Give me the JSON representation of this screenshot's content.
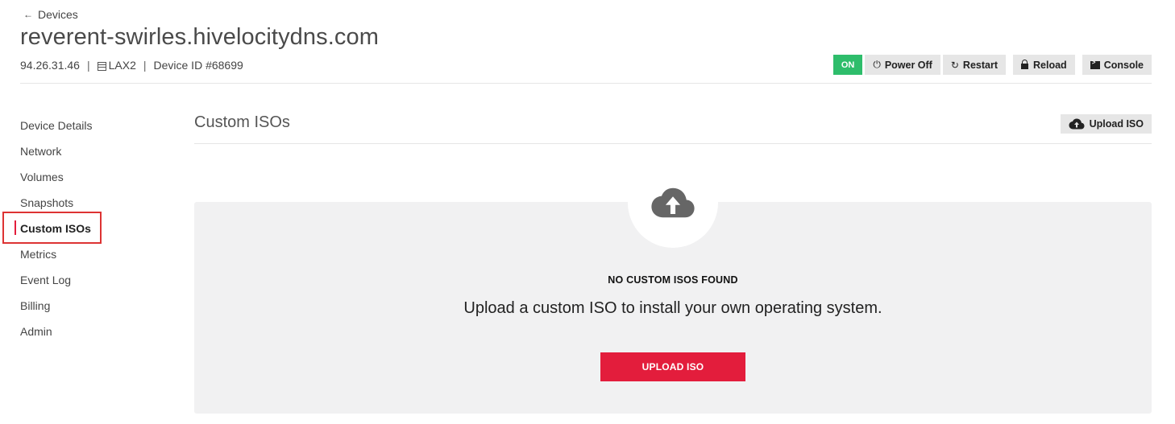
{
  "header": {
    "back_label": "Devices",
    "device_name": "reverent-swirles.hivelocitydns.com",
    "ip": "94.26.31.46",
    "datacenter": "LAX2",
    "device_id": "Device ID #68699"
  },
  "actions": {
    "status": "ON",
    "power_off": "Power Off",
    "restart": "Restart",
    "reload": "Reload",
    "console": "Console",
    "status_color": "#2ebd6b"
  },
  "sidebar": {
    "items": [
      {
        "label": "Device Details"
      },
      {
        "label": "Network"
      },
      {
        "label": "Volumes"
      },
      {
        "label": "Snapshots"
      },
      {
        "label": "Custom ISOs"
      },
      {
        "label": "Metrics"
      },
      {
        "label": "Event Log"
      },
      {
        "label": "Billing"
      },
      {
        "label": "Admin"
      }
    ],
    "active_index": 4,
    "accent_color": "#e31d3c"
  },
  "main": {
    "title": "Custom ISOs",
    "upload_button": "Upload ISO",
    "empty_state": {
      "icon": "cloud-upload-icon",
      "heading": "NO CUSTOM ISOS FOUND",
      "message": "Upload a custom ISO to install your own operating system.",
      "button": "UPLOAD ISO"
    }
  }
}
